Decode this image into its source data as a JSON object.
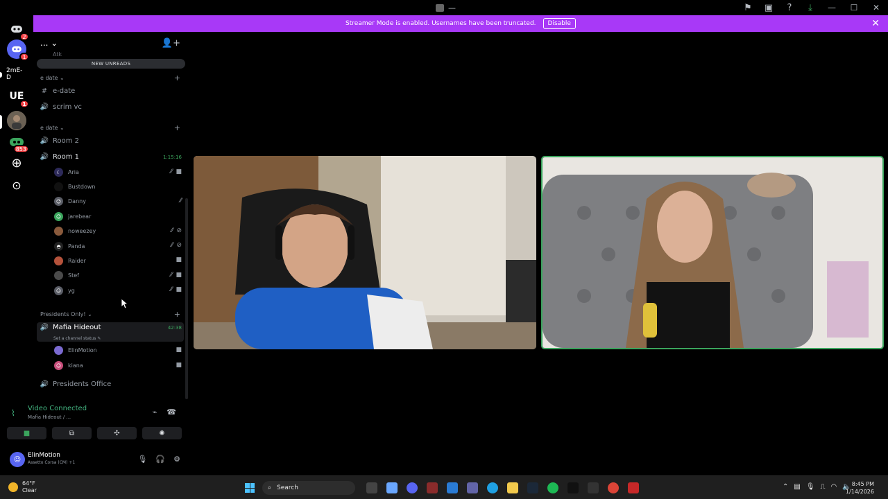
{
  "titlebar": {
    "window_title": "—",
    "icons": [
      "inbox-flag-icon",
      "screen-icon",
      "help-icon",
      "download-icon"
    ],
    "window_controls": [
      "minimize",
      "maximize",
      "close"
    ]
  },
  "rail": {
    "items": [
      {
        "name": "home",
        "badge": "2"
      },
      {
        "name": "server-discord",
        "badge": "1"
      },
      {
        "name": "server-2me",
        "label": "2mE-D"
      },
      {
        "name": "server-ue",
        "label": "UE",
        "badge": "1"
      },
      {
        "name": "server-photo"
      },
      {
        "name": "server-green",
        "badge": "853"
      },
      {
        "name": "add-server"
      },
      {
        "name": "discover"
      }
    ]
  },
  "banner": {
    "text": "Streamer Mode is enabled. Usernames have been truncated.",
    "button": "Disable"
  },
  "sidebar": {
    "server_name": "...",
    "new_unreads": "NEW UNREADS",
    "partial_top": "Atk",
    "categories": [
      {
        "label": "e date"
      },
      {
        "label": "e date"
      },
      {
        "label": "Presidents Only!"
      }
    ],
    "channels": {
      "edate": "e-date",
      "scrim": "scrim vc",
      "room2": "Room 2",
      "room1": "Room 1",
      "room1_time": "1:15:16",
      "mafia": "Mafia Hideout",
      "mafia_time": "42:38",
      "mafia_status": "Set a channel status",
      "office": "Presidents Office"
    },
    "room1_members": [
      "Aria",
      "Bustdown",
      "Danny",
      "jarebear",
      "noweezey",
      "Panda",
      "Raider",
      "Stef",
      "yg"
    ],
    "mafia_members": [
      "ElinMotion",
      "kiana"
    ]
  },
  "voice": {
    "status": "Video Connected",
    "channel": "Mafia Hideout / ...",
    "buttons": [
      "camera",
      "screen-share",
      "activities",
      "soundboard"
    ]
  },
  "user": {
    "name": "ElinMotion",
    "activity": "Assetto Corsa (CM) +1"
  },
  "taskbar": {
    "temp": "64°F",
    "weather": "Clear",
    "search": "Search",
    "time": "8:45 PM",
    "date": "1/14/2026"
  },
  "colors": {
    "accent_green": "#3ba55d",
    "banner_purple": "#a839f7",
    "discord_blurple": "#5865f2",
    "badge_red": "#f23f43"
  }
}
